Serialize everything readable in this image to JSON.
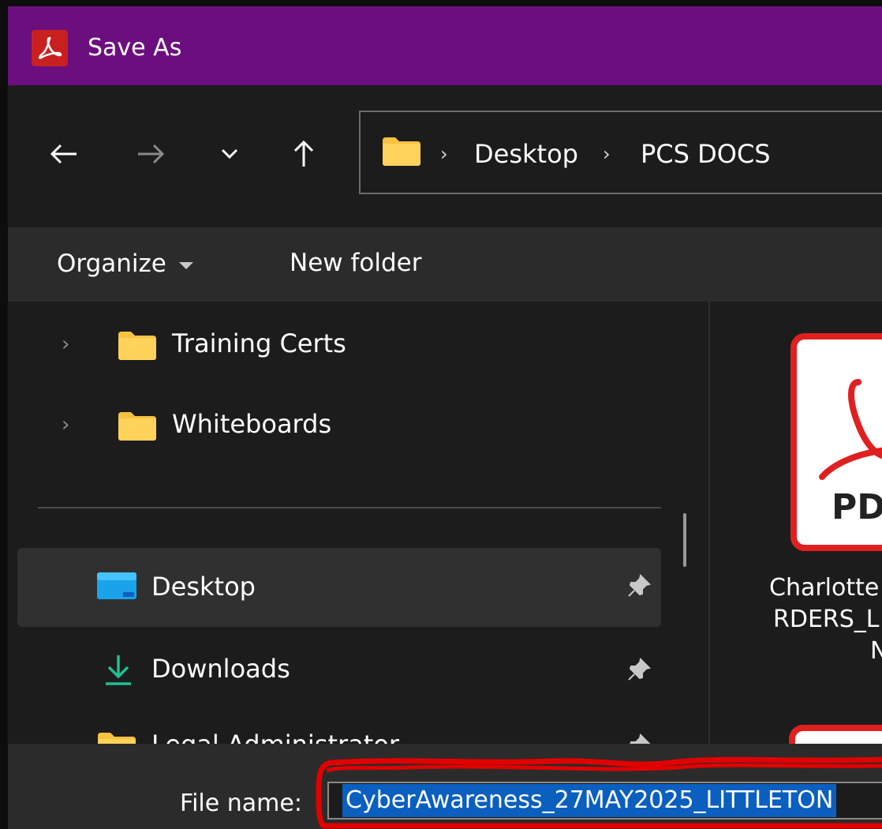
{
  "window": {
    "title": "Save As"
  },
  "nav": {
    "back": "←",
    "forward": "→",
    "recent": "⌄",
    "up": "↑"
  },
  "breadcrumb": {
    "separator": "›",
    "items": [
      "Desktop",
      "PCS DOCS"
    ]
  },
  "toolbar": {
    "organize_label": "Organize",
    "new_folder_label": "New folder"
  },
  "nav_pane": {
    "items": [
      {
        "label": "Training Certs",
        "icon": "folder-icon"
      },
      {
        "label": "Whiteboards",
        "icon": "folder-icon"
      },
      {
        "label": "Desktop",
        "icon": "desktop-icon",
        "pinned": true,
        "selected": true
      },
      {
        "label": "Downloads",
        "icon": "download-icon",
        "pinned": true
      },
      {
        "label": "Legal Administrator",
        "icon": "folder-icon",
        "pinned": true
      }
    ],
    "pin_glyph": "📌"
  },
  "content": {
    "files": [
      {
        "thumb_label": "PD",
        "caption_lines": [
          "Charlotte",
          "RDERS_L",
          "N"
        ]
      }
    ]
  },
  "bottom": {
    "filename_label": "File name:",
    "filename_value": "CyberAwareness_27MAY2025_LITTLETON"
  },
  "colors": {
    "titlebar": "#6b0f7e",
    "app_icon": "#c8201f",
    "selection": "#0a5fbf",
    "annotation": "#e00000",
    "folder": "#f5c242"
  }
}
